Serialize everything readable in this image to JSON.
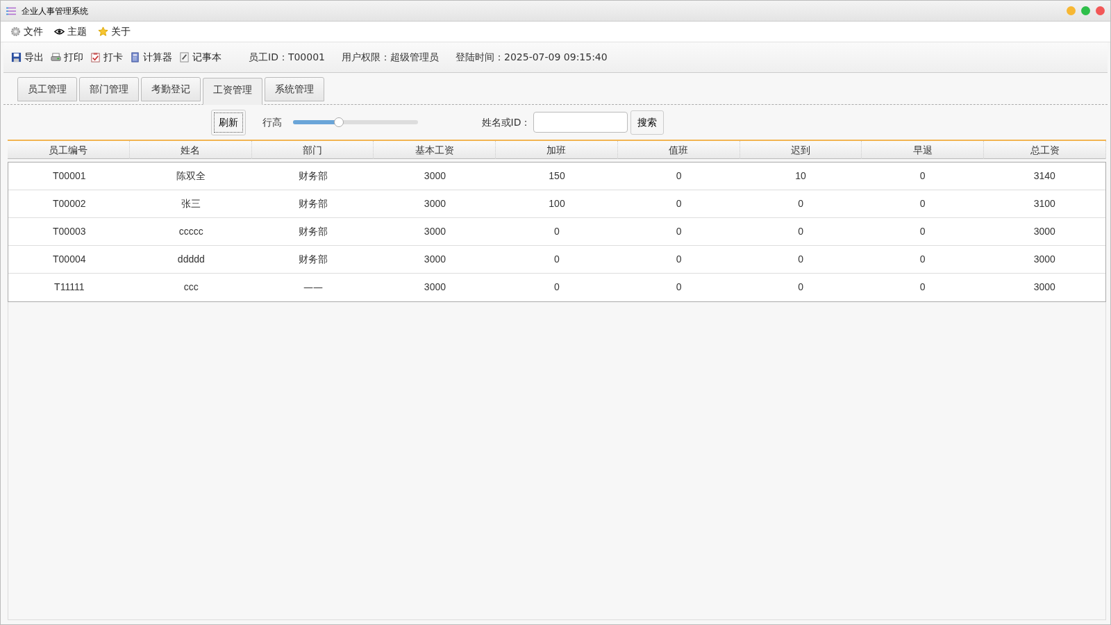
{
  "window": {
    "title": "企业人事管理系统"
  },
  "menu": [
    {
      "label": "文件",
      "kind": "gear"
    },
    {
      "label": "主题",
      "kind": "eye"
    },
    {
      "label": "关于",
      "kind": "star"
    }
  ],
  "toolbar": {
    "buttons": [
      {
        "label": "导出",
        "kind": "save"
      },
      {
        "label": "打印",
        "kind": "print"
      },
      {
        "label": "打卡",
        "kind": "clipboard"
      },
      {
        "label": "计算器",
        "kind": "calculator"
      },
      {
        "label": "记事本",
        "kind": "notepad"
      }
    ],
    "info": [
      "员工ID：T00001",
      "用户权限：超级管理员",
      "登陆时间：2025-07-09 09:15:40"
    ]
  },
  "tabs": [
    {
      "label": "员工管理",
      "selected": false
    },
    {
      "label": "部门管理",
      "selected": false
    },
    {
      "label": "考勤登记",
      "selected": false
    },
    {
      "label": "工资管理",
      "selected": true
    },
    {
      "label": "系统管理",
      "selected": false
    }
  ],
  "controls": {
    "refresh": "刷新",
    "row_height_label": "行高",
    "row_height_slider": {
      "level": 0.37
    },
    "search_label": "姓名或ID：",
    "search_button": "搜索"
  },
  "table": {
    "columns": [
      "员工编号",
      "姓名",
      "部门",
      "基本工资",
      "加班",
      "值班",
      "迟到",
      "早退",
      "总工资"
    ],
    "rows": [
      [
        "T00001",
        "陈双全",
        "财务部",
        "3000",
        "150",
        "0",
        "10",
        "0",
        "3140"
      ],
      [
        "T00002",
        "张三",
        "财务部",
        "3000",
        "100",
        "0",
        "0",
        "0",
        "3100"
      ],
      [
        "T00003",
        "ccccc",
        "财务部",
        "3000",
        "0",
        "0",
        "0",
        "0",
        "3000"
      ],
      [
        "T00004",
        "ddddd",
        "财务部",
        "3000",
        "0",
        "0",
        "0",
        "0",
        "3000"
      ],
      [
        "T11111",
        "ccc",
        "——",
        "3000",
        "0",
        "0",
        "0",
        "0",
        "3000"
      ]
    ]
  }
}
